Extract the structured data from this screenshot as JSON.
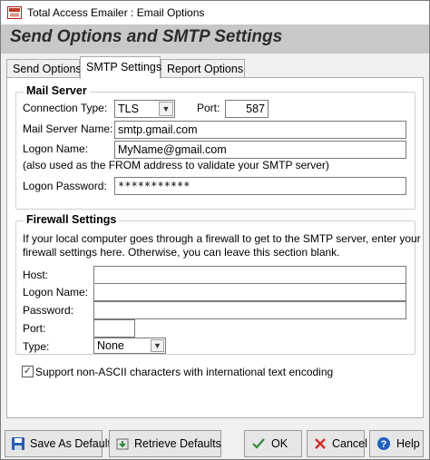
{
  "window": {
    "title": "Total Access Emailer : Email Options"
  },
  "header": {
    "title": "Send Options and SMTP Settings"
  },
  "tabs": [
    {
      "label": "Send Options"
    },
    {
      "label": "SMTP Settings"
    },
    {
      "label": "Report Options"
    }
  ],
  "mail_server": {
    "group_title": "Mail Server",
    "connection_type_label": "Connection Type:",
    "connection_type_value": "TLS",
    "port_label": "Port:",
    "port_value": "587",
    "server_name_label": "Mail Server Name:",
    "server_name_value": "smtp.gmail.com",
    "logon_name_label": "Logon Name:",
    "logon_name_value": "MyName@gmail.com",
    "logon_note": "(also used as the FROM address to validate your SMTP server)",
    "password_label": "Logon Password:",
    "password_value": "***********"
  },
  "firewall": {
    "group_title": "Firewall Settings",
    "description_line1": "If your local computer goes through a firewall to get to the SMTP server, enter your",
    "description_line2": "firewall settings here. Otherwise, you can leave this section blank.",
    "host_label": "Host:",
    "host_value": "",
    "logon_name_label": "Logon Name:",
    "logon_name_value": "",
    "password_label": "Password:",
    "password_value": "",
    "port_label": "Port:",
    "port_value": "",
    "type_label": "Type:",
    "type_value": "None"
  },
  "encoding_option": {
    "label": "Support non-ASCII characters with international text encoding",
    "checked": true
  },
  "buttons": {
    "save_default": "Save As Default",
    "retrieve_defaults": "Retrieve Defaults",
    "ok": "OK",
    "cancel": "Cancel",
    "help": "Help"
  },
  "colors": {
    "header_band": "#c8c8c8",
    "ok_check": "#2e8b3a",
    "cancel_x": "#d22b2b",
    "help_blue": "#1f5fbf"
  }
}
